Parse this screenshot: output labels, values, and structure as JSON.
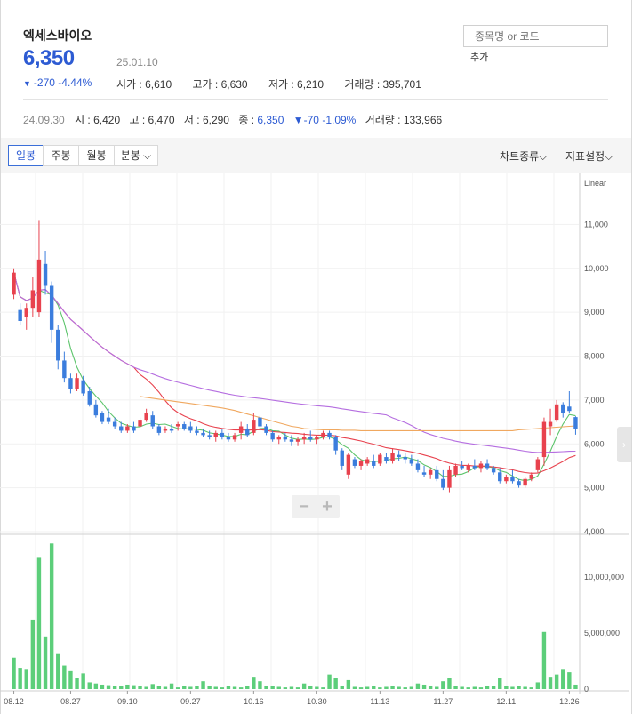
{
  "header": {
    "stock_name": "엑세스바이오",
    "price": "6,350",
    "date": "25.01.10",
    "change": "-270",
    "change_pct": "-4.44%",
    "open_label": "시가 : ",
    "open": "6,610",
    "high_label": "고가 : ",
    "high": "6,630",
    "low_label": "저가 : ",
    "low": "6,210",
    "volume_label": "거래량 : ",
    "volume": "395,701"
  },
  "search": {
    "placeholder": "종목명 or 코드",
    "add_label": "추가"
  },
  "history": {
    "date": "24.09.30",
    "open_label": "시 : ",
    "open": "6,420",
    "high_label": "고 : ",
    "high": "6,470",
    "low_label": "저 : ",
    "low": "6,290",
    "close_label": "종 : ",
    "close": "6,350",
    "change": "-70",
    "change_pct": "-1.09%",
    "volume_label": "거래량 : ",
    "volume": "133,966"
  },
  "toolbar": {
    "daily": "일봉",
    "weekly": "주봉",
    "monthly": "월봉",
    "minute": "분봉",
    "chart_type": "차트종류",
    "indicator": "지표설정"
  },
  "colors": {
    "up": "#e8424e",
    "down": "#3b7ddd",
    "ma5": "#5cc46b",
    "ma20": "#e8424e",
    "ma60": "#b56ee0",
    "ma120": "#f0a860",
    "volume": "#5cce7a",
    "accent": "#2d5bd3"
  },
  "chart_data": {
    "type": "candlestick",
    "scale_label": "Linear",
    "price_ticks": [
      "4,000",
      "5,000",
      "6,000",
      "7,000",
      "8,000",
      "9,000",
      "10,000",
      "11,000"
    ],
    "volume_ticks": [
      "0",
      "5,000,000",
      "10,000,000"
    ],
    "ylim": [
      4000,
      12000
    ],
    "volume_ylim": [
      0,
      13500000
    ],
    "date_labels": [
      "08.12",
      "08.27",
      "09.10",
      "09.27",
      "10.16",
      "10.30",
      "11.13",
      "11.27",
      "12.11",
      "12.26"
    ],
    "ohlc": [
      [
        9400,
        10000,
        9300,
        9900
      ],
      [
        9050,
        9200,
        8700,
        8800
      ],
      [
        8900,
        9200,
        8600,
        9100
      ],
      [
        9100,
        9800,
        8900,
        9500
      ],
      [
        9000,
        11100,
        8900,
        10200
      ],
      [
        10100,
        10400,
        9400,
        9600
      ],
      [
        9600,
        9700,
        8300,
        8600
      ],
      [
        8600,
        8700,
        7700,
        7900
      ],
      [
        7900,
        8100,
        7400,
        7500
      ],
      [
        7500,
        7600,
        7150,
        7250
      ],
      [
        7250,
        7600,
        7200,
        7500
      ],
      [
        7450,
        7550,
        7100,
        7150
      ],
      [
        7200,
        7300,
        6850,
        6900
      ],
      [
        6900,
        7000,
        6600,
        6650
      ],
      [
        6700,
        6750,
        6450,
        6500
      ],
      [
        6600,
        6800,
        6450,
        6500
      ],
      [
        6500,
        6600,
        6350,
        6400
      ],
      [
        6400,
        6500,
        6250,
        6300
      ],
      [
        6300,
        6450,
        6250,
        6400
      ],
      [
        6400,
        6500,
        6250,
        6300
      ],
      [
        6400,
        6600,
        6380,
        6550
      ],
      [
        6550,
        6800,
        6500,
        6700
      ],
      [
        6650,
        6750,
        6350,
        6400
      ],
      [
        6400,
        6450,
        6200,
        6250
      ],
      [
        6300,
        6400,
        6250,
        6350
      ],
      [
        6350,
        6450,
        6250,
        6300
      ],
      [
        6400,
        6500,
        6300,
        6450
      ],
      [
        6450,
        6500,
        6300,
        6350
      ],
      [
        6400,
        6500,
        6250,
        6300
      ],
      [
        6300,
        6400,
        6200,
        6250
      ],
      [
        6250,
        6350,
        6150,
        6200
      ],
      [
        6200,
        6300,
        6100,
        6150
      ],
      [
        6150,
        6300,
        6050,
        6250
      ],
      [
        6250,
        6350,
        6100,
        6150
      ],
      [
        6150,
        6250,
        6050,
        6100
      ],
      [
        6100,
        6250,
        6050,
        6200
      ],
      [
        6250,
        6500,
        6100,
        6400
      ],
      [
        6350,
        6450,
        6150,
        6200
      ],
      [
        6250,
        6700,
        6200,
        6550
      ],
      [
        6600,
        6650,
        6350,
        6400
      ],
      [
        6400,
        6450,
        6200,
        6250
      ],
      [
        6250,
        6300,
        6050,
        6100
      ],
      [
        6100,
        6200,
        6000,
        6150
      ],
      [
        6150,
        6250,
        6050,
        6100
      ],
      [
        6100,
        6200,
        5950,
        6050
      ],
      [
        6050,
        6150,
        5950,
        6100
      ],
      [
        6100,
        6250,
        6000,
        6150
      ],
      [
        6150,
        6300,
        6050,
        6100
      ],
      [
        6100,
        6200,
        6000,
        6150
      ],
      [
        6150,
        6300,
        6100,
        6250
      ],
      [
        6250,
        6300,
        6100,
        6150
      ],
      [
        6150,
        6200,
        5750,
        5850
      ],
      [
        5850,
        5900,
        5400,
        5500
      ],
      [
        5300,
        5800,
        5200,
        5750
      ],
      [
        5650,
        5700,
        5450,
        5500
      ],
      [
        5500,
        5650,
        5400,
        5600
      ],
      [
        5550,
        5700,
        5500,
        5650
      ],
      [
        5600,
        5750,
        5450,
        5500
      ],
      [
        5550,
        5800,
        5500,
        5750
      ],
      [
        5700,
        5800,
        5550,
        5600
      ],
      [
        5600,
        5900,
        5550,
        5800
      ],
      [
        5750,
        5850,
        5600,
        5700
      ],
      [
        5700,
        5800,
        5550,
        5650
      ],
      [
        5650,
        5750,
        5500,
        5550
      ],
      [
        5550,
        5650,
        5350,
        5400
      ],
      [
        5350,
        5500,
        5250,
        5300
      ],
      [
        5300,
        5450,
        5200,
        5400
      ],
      [
        5400,
        5500,
        5150,
        5200
      ],
      [
        5200,
        5400,
        4950,
        5000
      ],
      [
        5000,
        5500,
        4900,
        5400
      ],
      [
        5300,
        5550,
        5250,
        5500
      ],
      [
        5500,
        5600,
        5400,
        5450
      ],
      [
        5400,
        5550,
        5350,
        5500
      ],
      [
        5500,
        5650,
        5400,
        5450
      ],
      [
        5450,
        5600,
        5350,
        5550
      ],
      [
        5550,
        5650,
        5400,
        5450
      ],
      [
        5450,
        5500,
        5300,
        5350
      ],
      [
        5350,
        5450,
        5100,
        5150
      ],
      [
        5150,
        5300,
        5100,
        5250
      ],
      [
        5250,
        5400,
        5100,
        5150
      ],
      [
        5150,
        5200,
        5000,
        5050
      ],
      [
        5050,
        5250,
        5000,
        5200
      ],
      [
        5200,
        5350,
        5150,
        5300
      ],
      [
        5400,
        5700,
        5350,
        5650
      ],
      [
        5700,
        6600,
        5500,
        6500
      ],
      [
        6400,
        6800,
        6200,
        6500
      ],
      [
        6550,
        7000,
        6500,
        6900
      ],
      [
        6900,
        6950,
        6600,
        6700
      ],
      [
        6850,
        7200,
        6700,
        6750
      ],
      [
        6610,
        6630,
        6210,
        6350
      ]
    ],
    "volume": [
      2800000,
      1900000,
      1800000,
      6200000,
      11800000,
      4700000,
      13000000,
      3200000,
      2100000,
      1600000,
      1000000,
      1400000,
      600000,
      500000,
      400000,
      350000,
      300000,
      250000,
      400000,
      350000,
      300000,
      200000,
      450000,
      250000,
      200000,
      500000,
      150000,
      300000,
      200000,
      250000,
      700000,
      300000,
      200000,
      150000,
      250000,
      200000,
      150000,
      250000,
      1100000,
      700000,
      300000,
      250000,
      200000,
      150000,
      200000,
      150000,
      500000,
      300000,
      200000,
      150000,
      1300000,
      1000000,
      300000,
      800000,
      200000,
      150000,
      200000,
      250000,
      150000,
      200000,
      300000,
      200000,
      150000,
      200000,
      500000,
      400000,
      300000,
      200000,
      700000,
      1000000,
      300000,
      200000,
      150000,
      200000,
      150000,
      300000,
      250000,
      1000000,
      300000,
      200000,
      250000,
      200000,
      150000,
      600000,
      5100000,
      1100000,
      1300000,
      1800000,
      1500000,
      400000
    ],
    "ma_series": [
      {
        "name": "MA5",
        "period": 5
      },
      {
        "name": "MA20",
        "period": 20
      },
      {
        "name": "MA60",
        "period": 60
      },
      {
        "name": "MA120",
        "values": [
          7080,
          7060,
          7040,
          7020,
          7000,
          6980,
          6960,
          6940,
          6920,
          6900,
          6880,
          6860,
          6840,
          6820,
          6790,
          6760,
          6720,
          6680,
          6640,
          6600,
          6560,
          6520,
          6480,
          6440,
          6400,
          6380,
          6350,
          6340,
          6330,
          6320,
          6320,
          6320,
          6310,
          6310,
          6310,
          6300,
          6300,
          6300,
          6300,
          6300,
          6300,
          6300,
          6300,
          6300,
          6300,
          6300,
          6300,
          6300,
          6300,
          6300,
          6300,
          6300,
          6300,
          6300,
          6300,
          6300,
          6300,
          6300,
          6300,
          6300,
          6320,
          6330,
          6340,
          6350,
          6360,
          6370,
          6380,
          6390,
          6400,
          6410
        ]
      }
    ]
  }
}
